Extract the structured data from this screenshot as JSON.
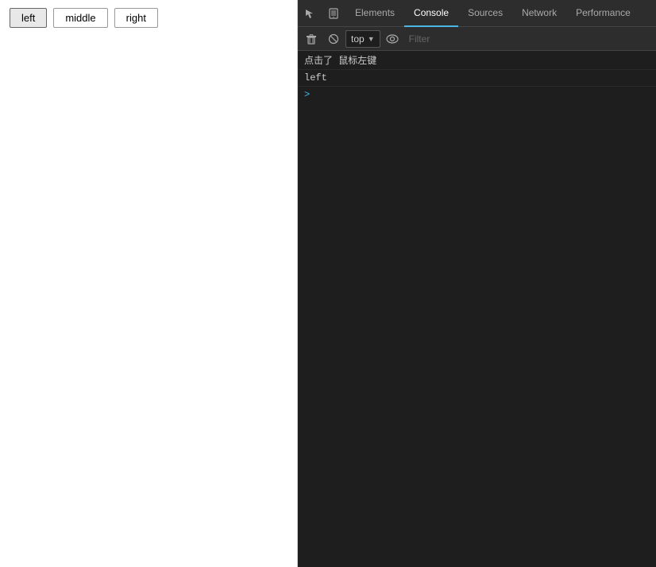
{
  "main": {
    "buttons": [
      {
        "label": "left",
        "id": "left-btn"
      },
      {
        "label": "middle",
        "id": "middle-btn"
      },
      {
        "label": "right",
        "id": "right-btn"
      }
    ]
  },
  "devtools": {
    "tabs": [
      {
        "label": "Elements",
        "active": false
      },
      {
        "label": "Console",
        "active": true
      },
      {
        "label": "Sources",
        "active": false
      },
      {
        "label": "Network",
        "active": false
      },
      {
        "label": "Performance",
        "active": false
      }
    ],
    "toolbar": {
      "top_select": "top",
      "filter_placeholder": "Filter"
    },
    "console": {
      "log1_text": "点击了 鼠标左键",
      "log2_text": "left",
      "prompt_symbol": ">"
    }
  }
}
